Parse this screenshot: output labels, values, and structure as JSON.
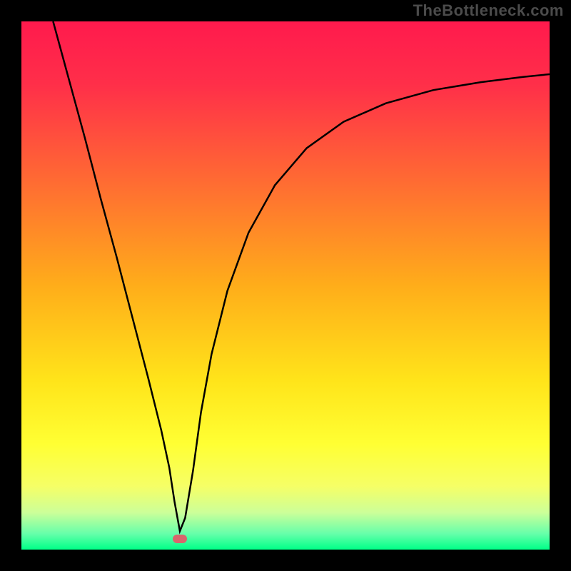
{
  "watermark": "TheBottleneck.com",
  "chart_data": {
    "type": "line",
    "title": "",
    "xlabel": "",
    "ylabel": "",
    "xlim": [
      0,
      1
    ],
    "ylim": [
      0,
      1
    ],
    "background_gradient": {
      "stops": [
        {
          "offset": 0.0,
          "color": "#ff1a4d"
        },
        {
          "offset": 0.12,
          "color": "#ff2f49"
        },
        {
          "offset": 0.3,
          "color": "#ff6a33"
        },
        {
          "offset": 0.5,
          "color": "#ffad1a"
        },
        {
          "offset": 0.68,
          "color": "#ffe41a"
        },
        {
          "offset": 0.8,
          "color": "#ffff33"
        },
        {
          "offset": 0.88,
          "color": "#f6ff66"
        },
        {
          "offset": 0.93,
          "color": "#ccff99"
        },
        {
          "offset": 0.97,
          "color": "#66ffaa"
        },
        {
          "offset": 1.0,
          "color": "#00ff88"
        }
      ]
    },
    "series": [
      {
        "name": "bottleneck-curve",
        "color": "#000000",
        "x": [
          0.06,
          0.09,
          0.12,
          0.15,
          0.18,
          0.21,
          0.24,
          0.265,
          0.28,
          0.29,
          0.3,
          0.31,
          0.325,
          0.34,
          0.36,
          0.39,
          0.43,
          0.48,
          0.54,
          0.61,
          0.69,
          0.78,
          0.87,
          0.95,
          1.0
        ],
        "y": [
          1.0,
          0.89,
          0.78,
          0.665,
          0.555,
          0.44,
          0.325,
          0.225,
          0.155,
          0.09,
          0.035,
          0.06,
          0.15,
          0.26,
          0.37,
          0.49,
          0.6,
          0.69,
          0.76,
          0.81,
          0.845,
          0.87,
          0.885,
          0.895,
          0.9
        ]
      }
    ],
    "markers": [
      {
        "name": "minimum-point",
        "x": 0.3,
        "y": 0.02,
        "color": "#d8666c"
      }
    ],
    "annotations": []
  }
}
